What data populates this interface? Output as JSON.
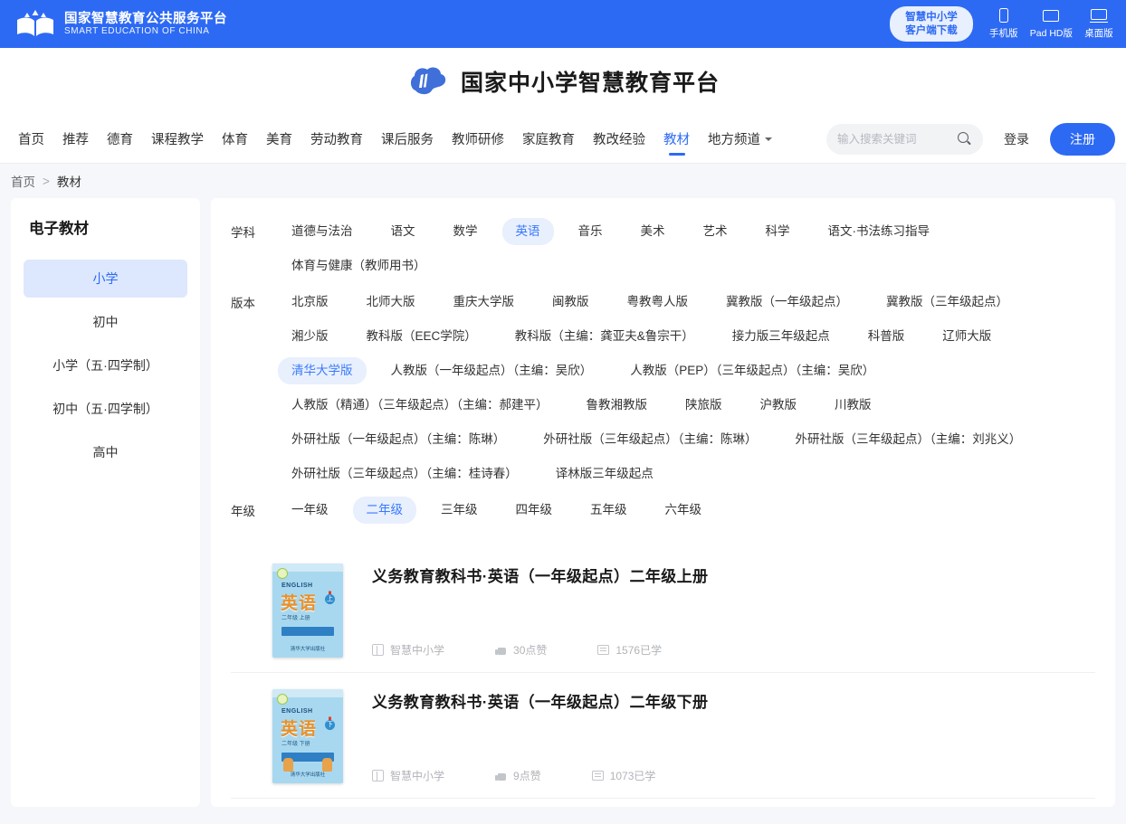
{
  "topbar": {
    "logo_cn": "国家智慧教育公共服务平台",
    "logo_en": "SMART EDUCATION OF CHINA",
    "client_button_line1": "智慧中小学",
    "client_button_line2": "客户端下载",
    "downloads": [
      {
        "label": "手机版",
        "icon": "phone-icon"
      },
      {
        "label": "Pad HD版",
        "icon": "tablet-icon"
      },
      {
        "label": "桌面版",
        "icon": "desktop-icon"
      }
    ]
  },
  "brand": {
    "title": "国家中小学智慧教育平台",
    "icon": "cloud-logo-icon"
  },
  "nav": {
    "items": [
      {
        "label": "首页",
        "active": false,
        "caret": false
      },
      {
        "label": "推荐",
        "active": false,
        "caret": false
      },
      {
        "label": "德育",
        "active": false,
        "caret": false
      },
      {
        "label": "课程教学",
        "active": false,
        "caret": false
      },
      {
        "label": "体育",
        "active": false,
        "caret": false
      },
      {
        "label": "美育",
        "active": false,
        "caret": false
      },
      {
        "label": "劳动教育",
        "active": false,
        "caret": false
      },
      {
        "label": "课后服务",
        "active": false,
        "caret": false
      },
      {
        "label": "教师研修",
        "active": false,
        "caret": false
      },
      {
        "label": "家庭教育",
        "active": false,
        "caret": false
      },
      {
        "label": "教改经验",
        "active": false,
        "caret": false
      },
      {
        "label": "教材",
        "active": true,
        "caret": false
      },
      {
        "label": "地方频道",
        "active": false,
        "caret": true
      }
    ],
    "search": {
      "placeholder": "输入搜索关键词",
      "value": ""
    },
    "login_label": "登录",
    "register_label": "注册"
  },
  "breadcrumb": {
    "home": "首页",
    "separator": ">",
    "current": "教材"
  },
  "sidebar": {
    "title": "电子教材",
    "items": [
      {
        "label": "小学",
        "active": true
      },
      {
        "label": "初中",
        "active": false
      },
      {
        "label": "小学（五·四学制）",
        "active": false
      },
      {
        "label": "初中（五·四学制）",
        "active": false
      },
      {
        "label": "高中",
        "active": false
      }
    ]
  },
  "filters": [
    {
      "label": "学科",
      "chips": [
        {
          "label": "道德与法治",
          "active": false
        },
        {
          "label": "语文",
          "active": false
        },
        {
          "label": "数学",
          "active": false
        },
        {
          "label": "英语",
          "active": true
        },
        {
          "label": "音乐",
          "active": false
        },
        {
          "label": "美术",
          "active": false
        },
        {
          "label": "艺术",
          "active": false
        },
        {
          "label": "科学",
          "active": false
        },
        {
          "label": "语文·书法练习指导",
          "active": false
        },
        {
          "label": "体育与健康（教师用书）",
          "active": false
        }
      ]
    },
    {
      "label": "版本",
      "chips": [
        {
          "label": "北京版",
          "active": false
        },
        {
          "label": "北师大版",
          "active": false
        },
        {
          "label": "重庆大学版",
          "active": false
        },
        {
          "label": "闽教版",
          "active": false
        },
        {
          "label": "粤教粤人版",
          "active": false
        },
        {
          "label": "冀教版（一年级起点）",
          "active": false
        },
        {
          "label": "冀教版（三年级起点）",
          "active": false
        },
        {
          "label": "湘少版",
          "active": false
        },
        {
          "label": "教科版（EEC学院）",
          "active": false
        },
        {
          "label": "教科版（主编：龚亚夫&鲁宗干）",
          "active": false
        },
        {
          "label": "接力版三年级起点",
          "active": false
        },
        {
          "label": "科普版",
          "active": false
        },
        {
          "label": "辽师大版",
          "active": false
        },
        {
          "label": "清华大学版",
          "active": true
        },
        {
          "label": "人教版（一年级起点）（主编：吴欣）",
          "active": false
        },
        {
          "label": "人教版（PEP）（三年级起点）（主编：吴欣）",
          "active": false
        },
        {
          "label": "人教版（精通）（三年级起点）（主编：郝建平）",
          "active": false
        },
        {
          "label": "鲁教湘教版",
          "active": false
        },
        {
          "label": "陕旅版",
          "active": false
        },
        {
          "label": "沪教版",
          "active": false
        },
        {
          "label": "川教版",
          "active": false
        },
        {
          "label": "外研社版（一年级起点）（主编：陈琳）",
          "active": false
        },
        {
          "label": "外研社版（三年级起点）（主编：陈琳）",
          "active": false
        },
        {
          "label": "外研社版（三年级起点）（主编：刘兆义）",
          "active": false
        },
        {
          "label": "外研社版（三年级起点）（主编：桂诗春）",
          "active": false
        },
        {
          "label": "译林版三年级起点",
          "active": false
        }
      ]
    },
    {
      "label": "年级",
      "chips": [
        {
          "label": "一年级",
          "active": false
        },
        {
          "label": "二年级",
          "active": true
        },
        {
          "label": "三年级",
          "active": false
        },
        {
          "label": "四年级",
          "active": false
        },
        {
          "label": "五年级",
          "active": false
        },
        {
          "label": "六年级",
          "active": false
        }
      ]
    }
  ],
  "books": [
    {
      "title": "义务教育教科书·英语（一年级起点）二年级上册",
      "source": "智慧中小学",
      "likes": "30点赞",
      "studied": "1576已学",
      "cover": {
        "eng": "ENGLISH",
        "cn": "英语",
        "bang": "!",
        "volume": "上",
        "sub": "二年级 上册",
        "publisher": "清华大学出版社",
        "kids": false
      }
    },
    {
      "title": "义务教育教科书·英语（一年级起点）二年级下册",
      "source": "智慧中小学",
      "likes": "9点赞",
      "studied": "1073已学",
      "cover": {
        "eng": "ENGLISH",
        "cn": "英语",
        "bang": "!",
        "volume": "下",
        "sub": "二年级 下册",
        "publisher": "清华大学出版社",
        "kids": true
      }
    }
  ],
  "colors": {
    "accent": "#2d6af4",
    "chip_active_bg": "#e8effd",
    "sidebar_active_bg": "#dde7fd"
  }
}
